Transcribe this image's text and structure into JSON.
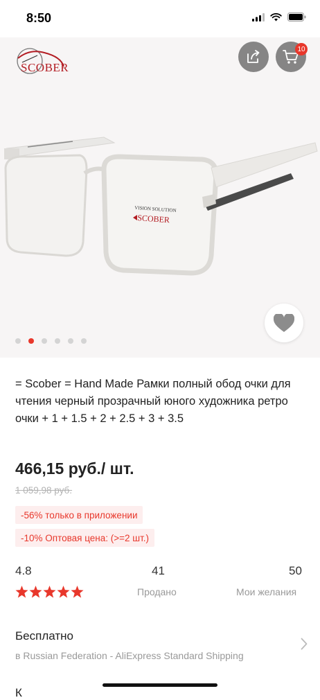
{
  "status_bar": {
    "time": "8:50"
  },
  "hero": {
    "brand": "SCOBER",
    "cart_count": "10",
    "image_count": 6,
    "active_image": 1
  },
  "product": {
    "title": "= Scober = Hand Made Рамки полный обод очки для чтения черный прозрачный юного художника ретро очки + 1 + 1.5 + 2 + 2.5 + 3 + 3.5",
    "price": "466,15 руб./ шт.",
    "old_price": "1 059,98 руб.",
    "promos": [
      "-56% только в приложении",
      "-10% Оптовая цена: (>=2 шт.)"
    ]
  },
  "stats": {
    "rating": "4.8",
    "rating_stars": 5,
    "sold_count": "41",
    "sold_label": "Продано",
    "wishlist_count": "50",
    "wishlist_label": "Мои желания"
  },
  "shipping": {
    "title": "Бесплатно",
    "subtitle": "в Russian Federation - AliExpress Standard Shipping"
  },
  "next_row": {
    "label": "К"
  },
  "colors": {
    "accent": "#e8372b",
    "brand": "#b31d23",
    "muted": "#999999"
  }
}
